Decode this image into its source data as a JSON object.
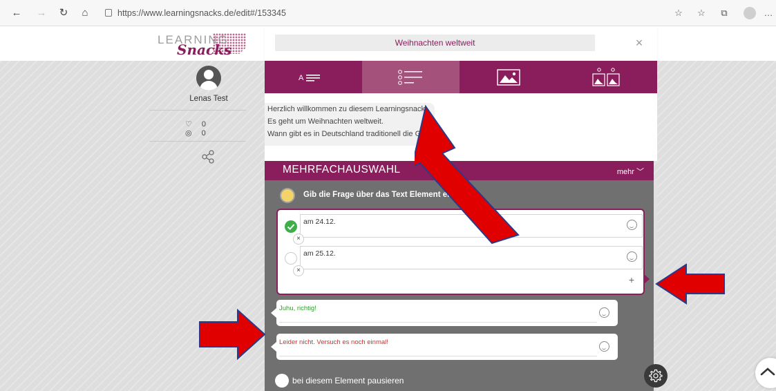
{
  "browser": {
    "url": "https://www.learningsnacks.de/edit#/153345",
    "back_icon": "arrow-left-icon",
    "forward_icon": "arrow-right-icon",
    "reload_icon": "reload-icon",
    "home_icon": "home-icon"
  },
  "logo": {
    "line1": "LEARNING",
    "line2": "Snacks"
  },
  "user": {
    "name": "Lenas Test",
    "likes": "0",
    "views": "0"
  },
  "editor": {
    "title": "Weihnachten weltweit",
    "tabs": [
      "text-tab",
      "multiple-choice-tab",
      "image-tab",
      "image-choice-tab"
    ],
    "welcome_lines": [
      "Herzlich willkommen zu diesem Learningsnack.",
      "Es geht um Weihnachten weltweit.",
      "Wann gibt es in Deutschland traditionell die G"
    ],
    "section_title": "MEHRFACHAUSWAHL",
    "more_label": "mehr",
    "hint": "Gib die Frage über das Text Element ein",
    "answers": [
      {
        "text": "am 24.12.",
        "correct": true
      },
      {
        "text": "am 25.12.",
        "correct": false
      }
    ],
    "feedback_correct": "Juhu, richtig!",
    "feedback_wrong": "Leider nicht. Versuch es noch einmal!",
    "pause_label": "bei diesem Element pausieren"
  },
  "colors": {
    "brand": "#8a1d5b",
    "arrow": "#e00000",
    "correct": "#3fae49"
  }
}
